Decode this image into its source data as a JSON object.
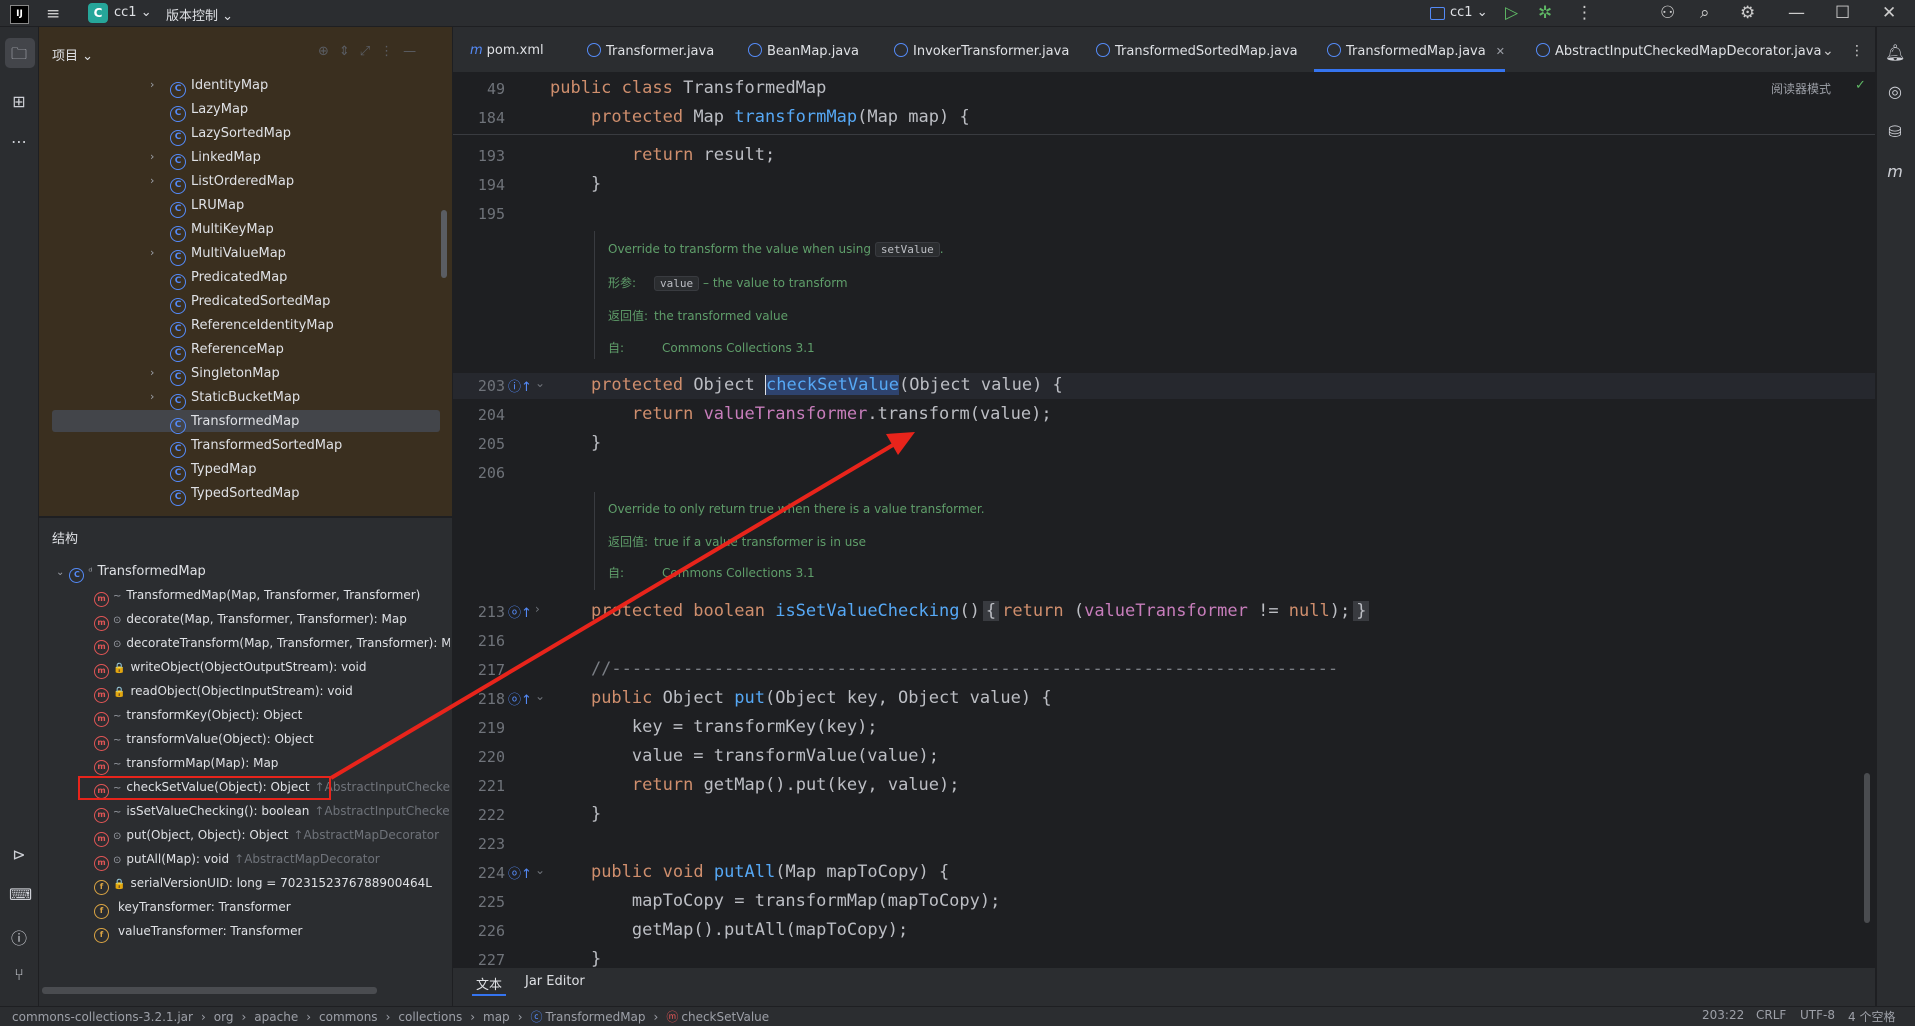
{
  "titlebar": {
    "logo": "IJ",
    "project_badge": "C",
    "project_name": "cc1",
    "vcs_label": "版本控制",
    "run_config": "cc1"
  },
  "project_panel": {
    "title": "项目",
    "items": [
      {
        "label": "IdentityMap",
        "arrow": true
      },
      {
        "label": "LazyMap",
        "arrow": false
      },
      {
        "label": "LazySortedMap",
        "arrow": false
      },
      {
        "label": "LinkedMap",
        "arrow": true
      },
      {
        "label": "ListOrderedMap",
        "arrow": true
      },
      {
        "label": "LRUMap",
        "arrow": false
      },
      {
        "label": "MultiKeyMap",
        "arrow": false
      },
      {
        "label": "MultiValueMap",
        "arrow": true
      },
      {
        "label": "PredicatedMap",
        "arrow": false
      },
      {
        "label": "PredicatedSortedMap",
        "arrow": false
      },
      {
        "label": "ReferenceIdentityMap",
        "arrow": false
      },
      {
        "label": "ReferenceMap",
        "arrow": false
      },
      {
        "label": "SingletonMap",
        "arrow": true
      },
      {
        "label": "StaticBucketMap",
        "arrow": true
      },
      {
        "label": "TransformedMap",
        "arrow": false
      },
      {
        "label": "TransformedSortedMap",
        "arrow": false
      },
      {
        "label": "TypedMap",
        "arrow": false
      },
      {
        "label": "TypedSortedMap",
        "arrow": false
      }
    ]
  },
  "structure_panel": {
    "title": "结构",
    "root": "TransformedMap",
    "items": [
      {
        "label": "TransformedMap(Map, Transformer, Transformer)",
        "inherit": "",
        "kind": "m",
        "vis": "~"
      },
      {
        "label": "decorate(Map, Transformer, Transformer): Map",
        "inherit": "",
        "kind": "m",
        "vis": "⊙"
      },
      {
        "label": "decorateTransform(Map, Transformer, Transformer): M",
        "inherit": "",
        "kind": "m",
        "vis": "⊙"
      },
      {
        "label": "writeObject(ObjectOutputStream): void",
        "inherit": "",
        "kind": "m",
        "vis": "🔒"
      },
      {
        "label": "readObject(ObjectInputStream): void",
        "inherit": "",
        "kind": "m",
        "vis": "🔒"
      },
      {
        "label": "transformKey(Object): Object",
        "inherit": "",
        "kind": "m",
        "vis": "~"
      },
      {
        "label": "transformValue(Object): Object",
        "inherit": "",
        "kind": "m",
        "vis": "~"
      },
      {
        "label": "transformMap(Map): Map",
        "inherit": "",
        "kind": "m",
        "vis": "~"
      },
      {
        "label": "checkSetValue(Object): Object",
        "inherit": "↑AbstractInputCheckedM",
        "kind": "m",
        "vis": "~"
      },
      {
        "label": "isSetValueChecking(): boolean",
        "inherit": "↑AbstractInputCheckedM",
        "kind": "m",
        "vis": "~"
      },
      {
        "label": "put(Object, Object): Object",
        "inherit": "↑AbstractMapDecorator",
        "kind": "m",
        "vis": "⊙"
      },
      {
        "label": "putAll(Map): void",
        "inherit": "↑AbstractMapDecorator",
        "kind": "m",
        "vis": "⊙"
      },
      {
        "label": "serialVersionUID: long = 7023152376788900464L",
        "inherit": "",
        "kind": "f",
        "vis": "🔒"
      },
      {
        "label": "keyTransformer: Transformer",
        "inherit": "",
        "kind": "f",
        "vis": ""
      },
      {
        "label": "valueTransformer: Transformer",
        "inherit": "",
        "kind": "f",
        "vis": ""
      }
    ]
  },
  "tabs": [
    {
      "label": "pom.xml"
    },
    {
      "label": "Transformer.java"
    },
    {
      "label": "BeanMap.java"
    },
    {
      "label": "InvokerTransformer.java"
    },
    {
      "label": "TransformedSortedMap.java"
    },
    {
      "label": "TransformedMap.java"
    },
    {
      "label": "AbstractInputCheckedMapDecorator.java"
    }
  ],
  "editor": {
    "reader_mode": "阅读器模式",
    "sticky": [
      {
        "num": "49",
        "code": "public class TransformedMap"
      },
      {
        "num": "184",
        "code": "    protected Map transformMap(Map map) {"
      }
    ],
    "lines_a": [
      {
        "num": "193",
        "code": "        return result;"
      },
      {
        "num": "194",
        "code": "    }"
      },
      {
        "num": "195",
        "code": ""
      }
    ],
    "doc1": {
      "desc_pre": "Override to transform the value when using",
      "desc_code": "setValue",
      "desc_post": ".",
      "param_label": "形参:",
      "param_code": "value",
      "param_text": "– the value to transform",
      "return_label": "返回值:",
      "return_text": "the transformed value",
      "since_label": "自:",
      "since_text": "Commons Collections 3.1"
    },
    "line203": {
      "num": "203"
    },
    "lines_b": [
      {
        "num": "204",
        "code": "        return valueTransformer.transform(value);"
      },
      {
        "num": "205",
        "code": "    }"
      },
      {
        "num": "206",
        "code": ""
      }
    ],
    "doc2": {
      "desc": "Override to only return true when there is a value transformer.",
      "return_label": "返回值:",
      "return_text": "true if a value transformer is in use",
      "since_label": "自:",
      "since_text": "Commons Collections 3.1"
    },
    "line213": {
      "num": "213"
    },
    "lines_c": [
      {
        "num": "216",
        "code": ""
      },
      {
        "num": "217",
        "code": "    //-----------------------------------------------------------------------"
      },
      {
        "num": "218",
        "code": "    public Object put(Object key, Object value) {"
      },
      {
        "num": "219",
        "code": "        key = transformKey(key);"
      },
      {
        "num": "220",
        "code": "        value = transformValue(value);"
      },
      {
        "num": "221",
        "code": "        return getMap().put(key, value);"
      },
      {
        "num": "222",
        "code": "    }"
      },
      {
        "num": "223",
        "code": ""
      },
      {
        "num": "224",
        "code": "    public void putAll(Map mapToCopy) {"
      },
      {
        "num": "225",
        "code": "        mapToCopy = transformMap(mapToCopy);"
      },
      {
        "num": "226",
        "code": "        getMap().putAll(mapToCopy);"
      },
      {
        "num": "227",
        "code": "    }"
      }
    ]
  },
  "bottom_tabs": {
    "text": "文本",
    "jar": "Jar Editor"
  },
  "statusbar": {
    "crumbs": [
      "commons-collections-3.2.1.jar",
      "org",
      "apache",
      "commons",
      "collections",
      "map",
      "TransformedMap",
      "checkSetValue"
    ],
    "position": "203:22",
    "line_sep": "CRLF",
    "encoding": "UTF-8",
    "indent": "4 个空格"
  },
  "colors": {
    "accent": "#3574f0",
    "annotation": "#e8241b",
    "keyword": "#cf8e6d",
    "function": "#56a8f5"
  }
}
